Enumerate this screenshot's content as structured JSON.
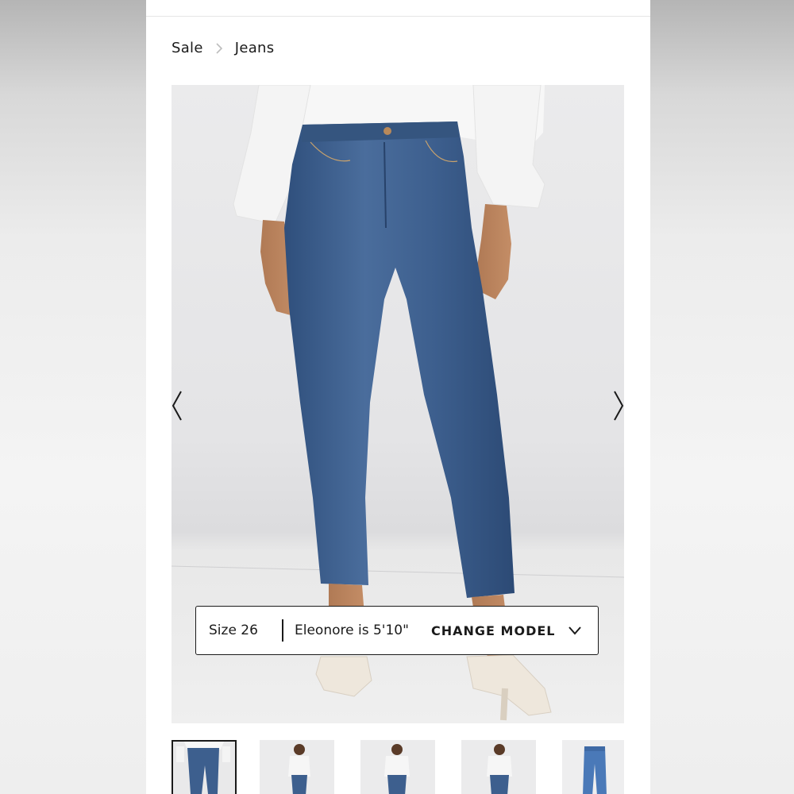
{
  "breadcrumb": {
    "items": [
      "Sale",
      "Jeans"
    ]
  },
  "gallery": {
    "prev_icon": "chevron-left-icon",
    "next_icon": "chevron-right-icon",
    "thumbnail_count": 5,
    "active_thumbnail": 1
  },
  "model_selector": {
    "size_label": "Size 26",
    "model_info": "Eleonore is 5'10\"",
    "change_label": "CHANGE MODEL",
    "icon": "chevron-down-icon"
  },
  "colors": {
    "denim": "#3d5f8e",
    "text": "#1a1a1a"
  }
}
